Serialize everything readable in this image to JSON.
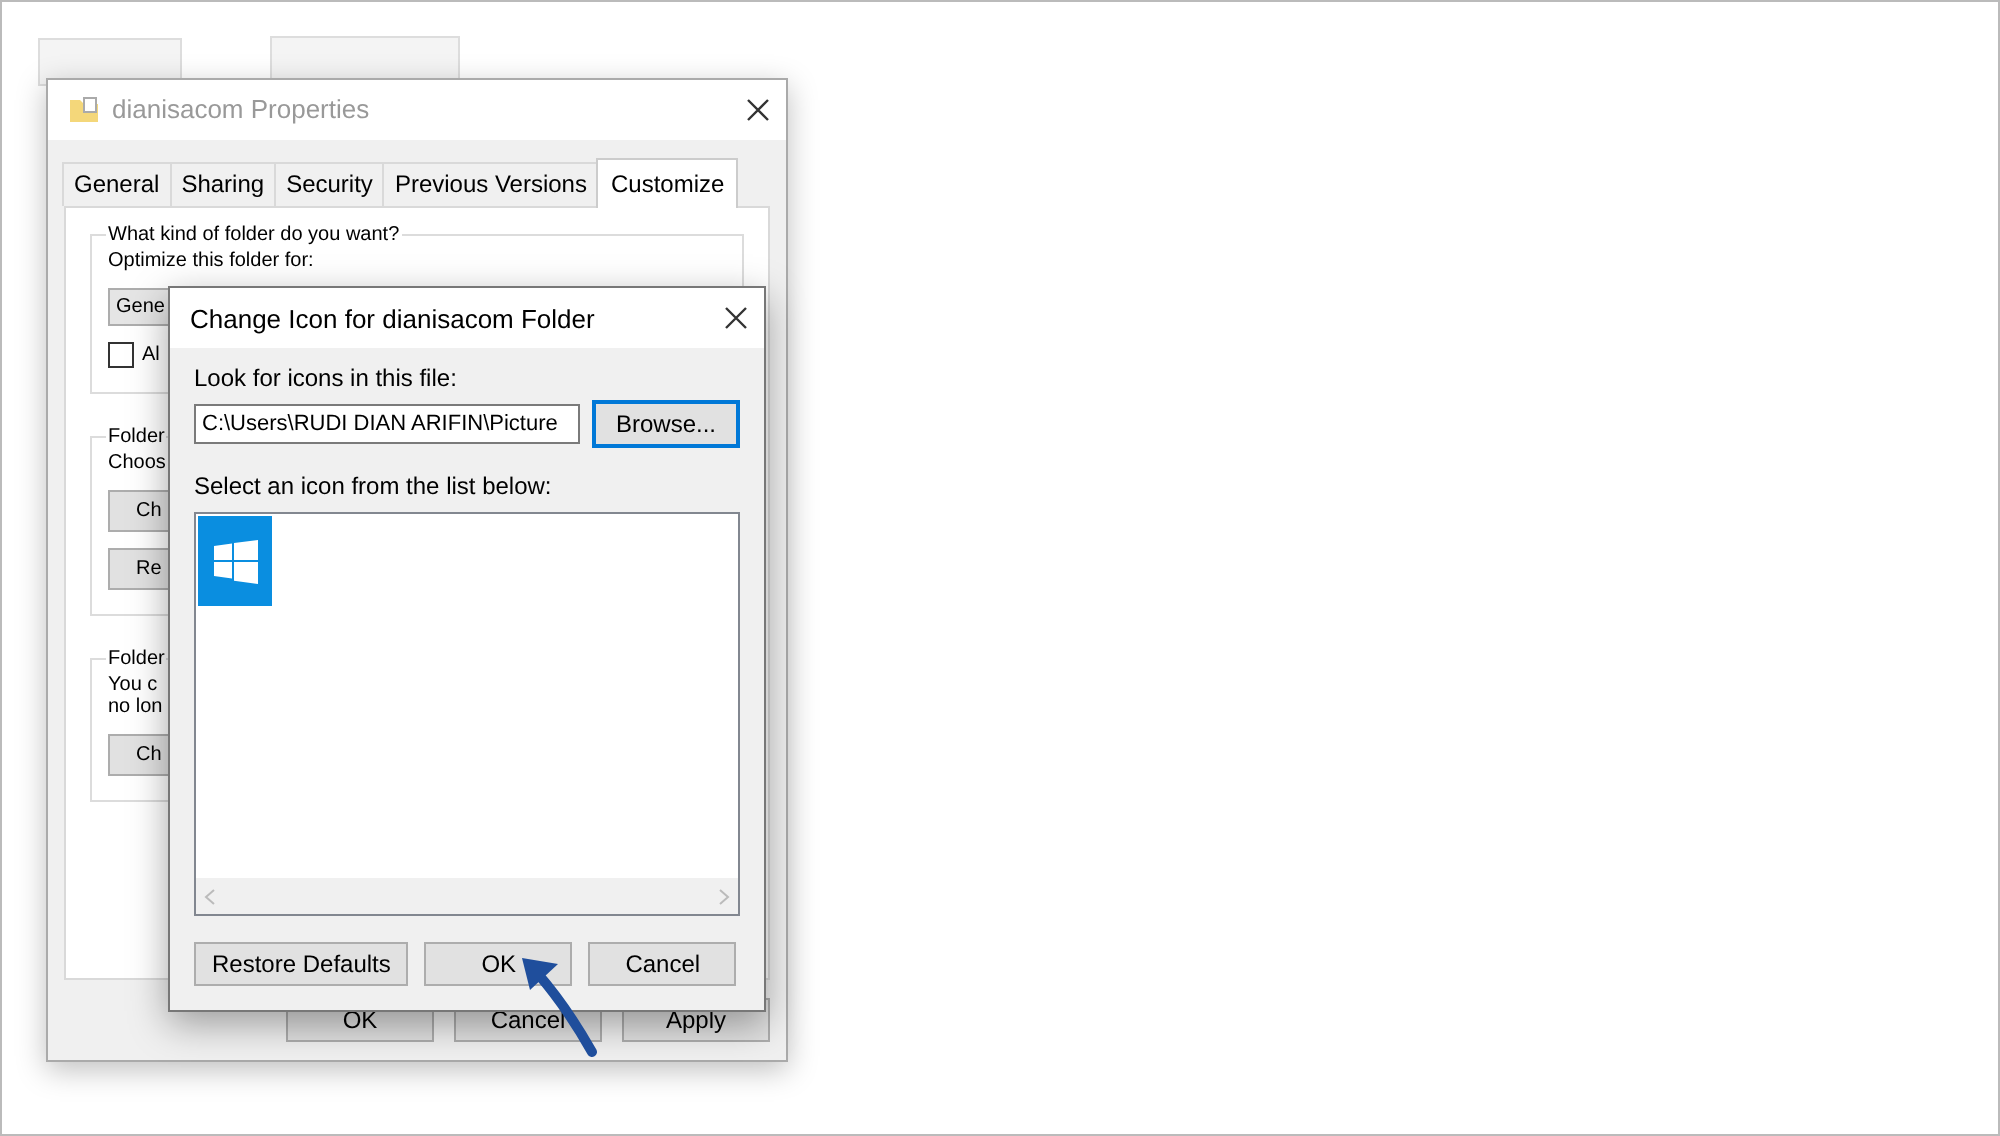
{
  "background_window": {
    "title": "dianisacom Properties",
    "tabs": [
      {
        "label": "General",
        "selected": false
      },
      {
        "label": "Sharing",
        "selected": false
      },
      {
        "label": "Security",
        "selected": false
      },
      {
        "label": "Previous Versions",
        "selected": false
      },
      {
        "label": "Customize",
        "selected": true
      }
    ],
    "folder_type_group": {
      "legend": "What kind of folder do you want?",
      "optimize_label": "Optimize this folder for:",
      "optimize_value": "Gene",
      "checkbox": {
        "label": "Al",
        "checked": false
      }
    },
    "pictures_group": {
      "legend": "Folder",
      "text_lines": [
        "Choos"
      ],
      "buttons": [
        "Ch",
        "Re"
      ]
    },
    "icons_group": {
      "legend": "Folder",
      "text_lines": [
        "You c",
        "no lon"
      ],
      "buttons": [
        "Ch"
      ]
    },
    "buttons": [
      "OK",
      "Cancel",
      "Apply"
    ]
  },
  "dialog": {
    "title": "Change Icon for dianisacom Folder",
    "file_label": "Look for icons in this file:",
    "file_value": "C:\\Users\\RUDI DIAN ARIFIN\\Picture",
    "browse_button": {
      "label": "Browse...",
      "focused": true
    },
    "list_label": "Select an icon from the list below:",
    "icons": [
      {
        "selected": true
      }
    ],
    "buttons": [
      "Restore Defaults",
      "OK",
      "Cancel"
    ]
  }
}
